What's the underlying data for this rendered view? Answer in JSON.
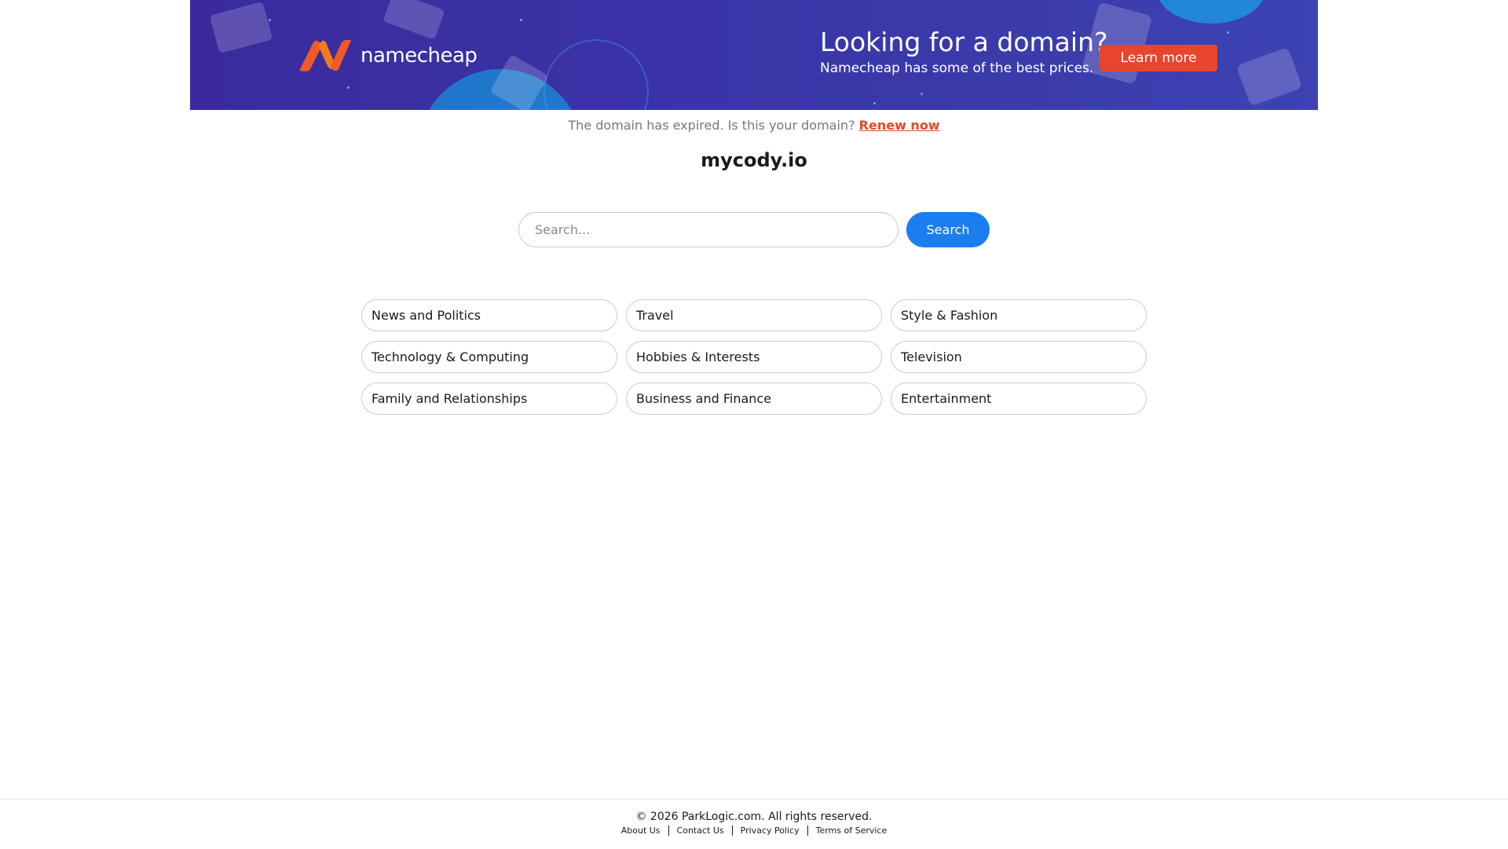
{
  "banner": {
    "logo_text": "namecheap",
    "title": "Looking for a domain?",
    "subtitle": "Namecheap has some of the best prices.",
    "cta_label": "Learn more",
    "colors": {
      "background": "#3a34a8",
      "logo_orange": "#f15a24",
      "cta": "#e8462c"
    }
  },
  "notice": {
    "text": "The domain has expired. Is this your domain?",
    "link_label": "Renew now"
  },
  "domain": "mycody.io",
  "search": {
    "placeholder": "Search...",
    "button_label": "Search"
  },
  "categories": [
    "News and Politics",
    "Travel",
    "Style & Fashion",
    "Technology & Computing",
    "Hobbies & Interests",
    "Television",
    "Family and Relationships",
    "Business and Finance",
    "Entertainment"
  ],
  "footer": {
    "copyright": "© 2026 ParkLogic.com. All rights reserved.",
    "links": [
      "About Us",
      "Contact Us",
      "Privacy Policy",
      "Terms of Service"
    ]
  }
}
